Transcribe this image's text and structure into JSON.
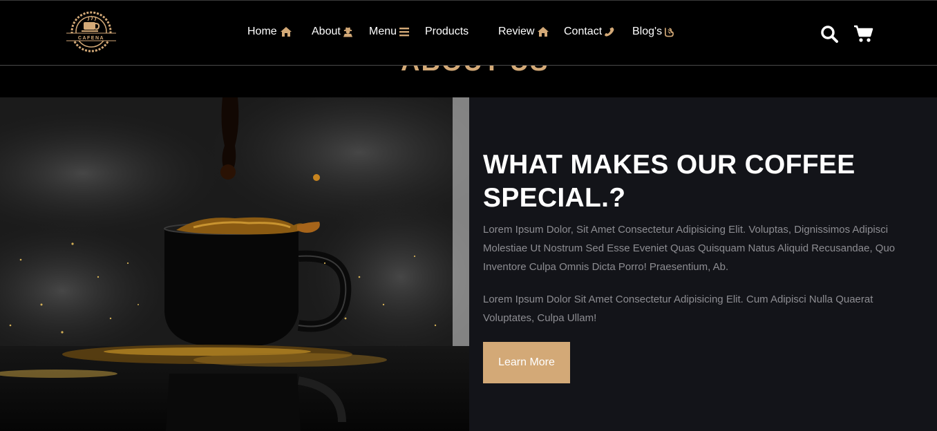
{
  "header": {
    "logo_text": "CAFENA",
    "nav": [
      {
        "label": "Home",
        "icon": "home-icon"
      },
      {
        "label": "About",
        "icon": "user-secret-icon"
      },
      {
        "label": "Menu",
        "icon": "bars-icon"
      },
      {
        "label": "Products",
        "icon": ""
      },
      {
        "label": "Review",
        "icon": "home-icon"
      },
      {
        "label": "Contact",
        "icon": "phone-icon"
      },
      {
        "label": "Blog's",
        "icon": "blogger-icon"
      }
    ],
    "search_icon": "search-icon",
    "cart_icon": "shopping-cart-icon"
  },
  "section_heading_ghost": "ABOUT US",
  "about": {
    "heading": "WHAT MAKES OUR COFFEE SPECIAL.?",
    "paragraph1": "Lorem Ipsum Dolor, Sit Amet Consectetur Adipisicing Elit. Voluptas, Dignissimos Adipisci Molestiae Ut Nostrum Sed Esse Eveniet Quas Quisquam Natus Aliquid Recusandae, Quo Inventore Culpa Omnis Dicta Porro! Praesentium, Ab.",
    "paragraph2": "Lorem Ipsum Dolor Sit Amet Consectetur Adipisicing Elit. Cum Adipisci Nulla Quaerat Voluptates, Culpa Ullam!",
    "button_label": "Learn More"
  },
  "colors": {
    "accent": "#d3a977",
    "background": "#000000",
    "panel": "#131419",
    "text_muted": "#8d8d92"
  }
}
